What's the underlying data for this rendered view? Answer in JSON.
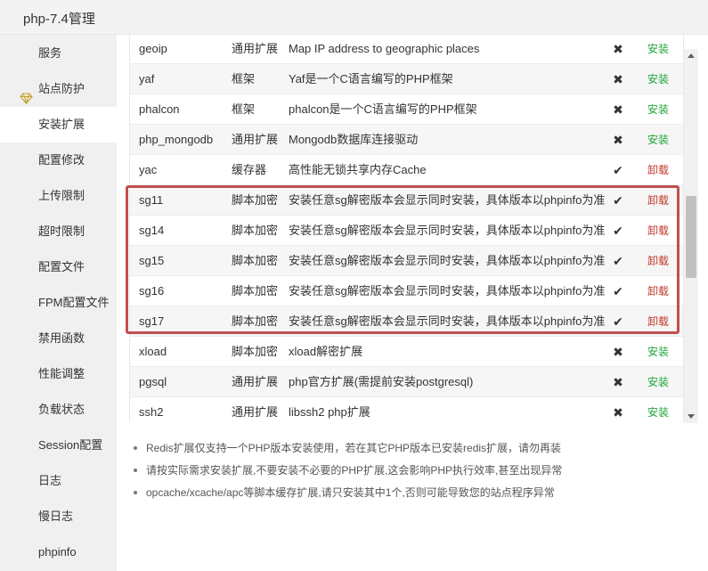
{
  "window": {
    "title": "php-7.4管理"
  },
  "sidebar": {
    "items": [
      {
        "label": "服务",
        "name": "sidebar-item-service"
      },
      {
        "label": "站点防护",
        "name": "sidebar-item-site-protection",
        "icon": "gem-icon"
      },
      {
        "label": "安装扩展",
        "name": "sidebar-item-install-extensions",
        "active": true
      },
      {
        "label": "配置修改",
        "name": "sidebar-item-config-edit"
      },
      {
        "label": "上传限制",
        "name": "sidebar-item-upload-limit"
      },
      {
        "label": "超时限制",
        "name": "sidebar-item-timeout-limit"
      },
      {
        "label": "配置文件",
        "name": "sidebar-item-config-file"
      },
      {
        "label": "FPM配置文件",
        "name": "sidebar-item-fpm-config"
      },
      {
        "label": "禁用函数",
        "name": "sidebar-item-disabled-functions"
      },
      {
        "label": "性能调整",
        "name": "sidebar-item-performance"
      },
      {
        "label": "负载状态",
        "name": "sidebar-item-load-status"
      },
      {
        "label": "Session配置",
        "name": "sidebar-item-session-config"
      },
      {
        "label": "日志",
        "name": "sidebar-item-log"
      },
      {
        "label": "慢日志",
        "name": "sidebar-item-slow-log"
      },
      {
        "label": "phpinfo",
        "name": "sidebar-item-phpinfo"
      }
    ]
  },
  "extensions": {
    "rows": [
      {
        "name": "geoip",
        "type": "通用扩展",
        "desc": "Map IP address to geographic places",
        "installed": false,
        "action": "安装"
      },
      {
        "name": "yaf",
        "type": "框架",
        "desc": "Yaf是一个C语言编写的PHP框架",
        "installed": false,
        "action": "安装"
      },
      {
        "name": "phalcon",
        "type": "框架",
        "desc": "phalcon是一个C语言编写的PHP框架",
        "installed": false,
        "action": "安装"
      },
      {
        "name": "php_mongodb",
        "type": "通用扩展",
        "desc": "Mongodb数据库连接驱动",
        "installed": false,
        "action": "安装"
      },
      {
        "name": "yac",
        "type": "缓存器",
        "desc": "高性能无锁共享内存Cache",
        "installed": true,
        "action": "卸载"
      },
      {
        "name": "sg11",
        "type": "脚本加密",
        "desc": "安装任意sg解密版本会显示同时安装，具体版本以phpinfo为准",
        "installed": true,
        "action": "卸载"
      },
      {
        "name": "sg14",
        "type": "脚本加密",
        "desc": "安装任意sg解密版本会显示同时安装，具体版本以phpinfo为准",
        "installed": true,
        "action": "卸载"
      },
      {
        "name": "sg15",
        "type": "脚本加密",
        "desc": "安装任意sg解密版本会显示同时安装，具体版本以phpinfo为准",
        "installed": true,
        "action": "卸载"
      },
      {
        "name": "sg16",
        "type": "脚本加密",
        "desc": "安装任意sg解密版本会显示同时安装，具体版本以phpinfo为准",
        "installed": true,
        "action": "卸载"
      },
      {
        "name": "sg17",
        "type": "脚本加密",
        "desc": "安装任意sg解密版本会显示同时安装，具体版本以phpinfo为准",
        "installed": true,
        "action": "卸载"
      },
      {
        "name": "xload",
        "type": "脚本加密",
        "desc": "xload解密扩展",
        "installed": false,
        "action": "安装"
      },
      {
        "name": "pgsql",
        "type": "通用扩展",
        "desc": "php官方扩展(需提前安装postgresql)",
        "installed": false,
        "action": "安装"
      },
      {
        "name": "ssh2",
        "type": "通用扩展",
        "desc": "libssh2 php扩展",
        "installed": false,
        "action": "安装"
      }
    ],
    "installed_mark": "✔",
    "not_installed_mark": "✖"
  },
  "colors": {
    "install": "#20a53a",
    "uninstall": "#c0392b",
    "highlight": "#c0504d"
  },
  "notes": [
    "Redis扩展仅支持一个PHP版本安装使用，若在其它PHP版本已安装redis扩展，请勿再装",
    "请按实际需求安装扩展,不要安装不必要的PHP扩展,这会影响PHP执行效率,甚至出现异常",
    "opcache/xcache/apc等脚本缓存扩展,请只安装其中1个,否则可能导致您的站点程序异常"
  ]
}
